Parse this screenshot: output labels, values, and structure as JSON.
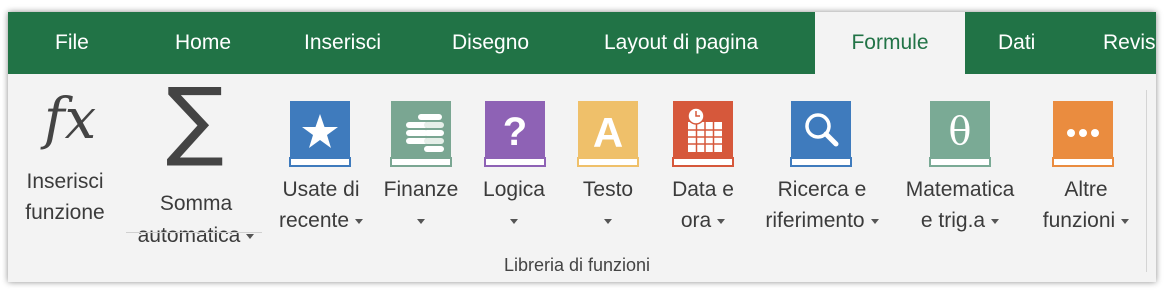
{
  "tabs": [
    {
      "label": "File",
      "active": false
    },
    {
      "label": "Home",
      "active": false
    },
    {
      "label": "Inserisci",
      "active": false
    },
    {
      "label": "Disegno",
      "active": false
    },
    {
      "label": "Layout di pagina",
      "active": false
    },
    {
      "label": "Formule",
      "active": true
    },
    {
      "label": "Dati",
      "active": false
    },
    {
      "label": "Revis",
      "active": false
    }
  ],
  "ribbon": {
    "insert_function": {
      "icon": "fx",
      "line1": "Inserisci",
      "line2": "funzione"
    },
    "autosum": {
      "icon": "∑",
      "line1": "Somma",
      "line2": "automatica"
    },
    "recent": {
      "line1": "Usate di",
      "line2": "recente",
      "icon": "star-book-icon"
    },
    "financial": {
      "line1": "Finanze",
      "icon": "coins-book-icon"
    },
    "logical": {
      "line1": "Logica",
      "icon": "?",
      "icon_name": "question-book-icon"
    },
    "text": {
      "line1": "Testo",
      "icon": "A",
      "icon_name": "text-book-icon"
    },
    "datetime": {
      "line1": "Data e",
      "line2": "ora",
      "icon": "calendar-book-icon"
    },
    "lookup": {
      "line1": "Ricerca e",
      "line2": "riferimento",
      "icon": "magnifier-book-icon"
    },
    "math": {
      "line1": "Matematica",
      "line2": "e trig.a",
      "icon": "θ",
      "icon_name": "theta-book-icon"
    },
    "more": {
      "line1": "Altre",
      "line2": "funzioni",
      "icon": "•••",
      "icon_name": "more-book-icon"
    },
    "group_label": "Libreria di funzioni"
  },
  "colors": {
    "accent": "#217346",
    "ribbon_bg": "#f3f3f3",
    "book_blue": "#3f7bbd",
    "book_green": "#7aa692",
    "book_purple": "#8e62b5",
    "book_yellow": "#efc06a",
    "book_red": "#d6583b",
    "book_teal": "#7aaa95",
    "book_orange": "#ea8c3f"
  }
}
